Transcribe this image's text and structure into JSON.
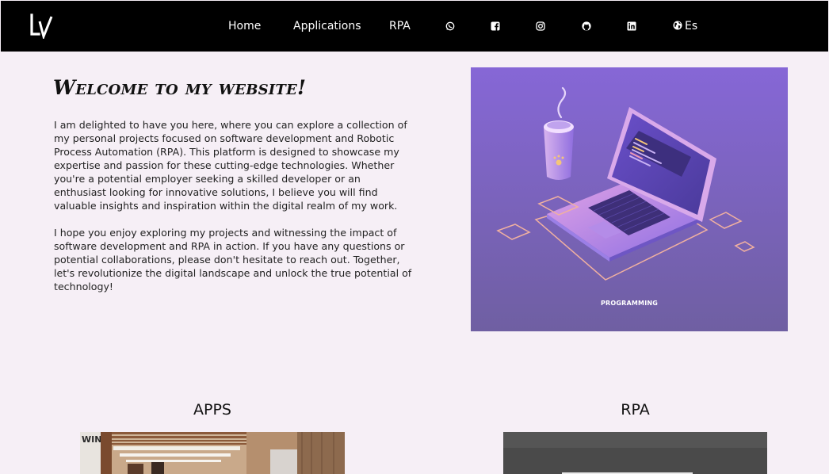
{
  "nav": {
    "items": [
      "Home",
      "Applications",
      "RPA"
    ],
    "socials": [
      "whatsapp-icon",
      "facebook-icon",
      "instagram-icon",
      "github-icon",
      "linkedin-icon"
    ],
    "language_label": "Es"
  },
  "intro": {
    "title": "Welcome to my website!",
    "paragraphs": [
      "I am delighted to have you here, where you can explore a collection of my personal projects focused on software development and Robotic Process Automation (RPA). This platform is designed to showcase my expertise and passion for these cutting-edge technologies. Whether you're a potential employer seeking a skilled developer or an enthusiast looking for innovative solutions, I believe you will find valuable insights and inspiration within the digital realm of my work.",
      "I hope you enjoy exploring my projects and witnessing the impact of software development and RPA in action. If you have any questions or potential collaborations, please don't hesitate to reach out. Together, let's revolutionize the digital landscape and unlock the true potential of technology!"
    ]
  },
  "hero": {
    "caption": "PROGRAMMING"
  },
  "sections": [
    {
      "title": "APPS"
    },
    {
      "title": "RPA"
    }
  ],
  "colors": {
    "page_background": "#f6eff6",
    "navbar": "#000000",
    "hero_purple": "#8466d4"
  }
}
